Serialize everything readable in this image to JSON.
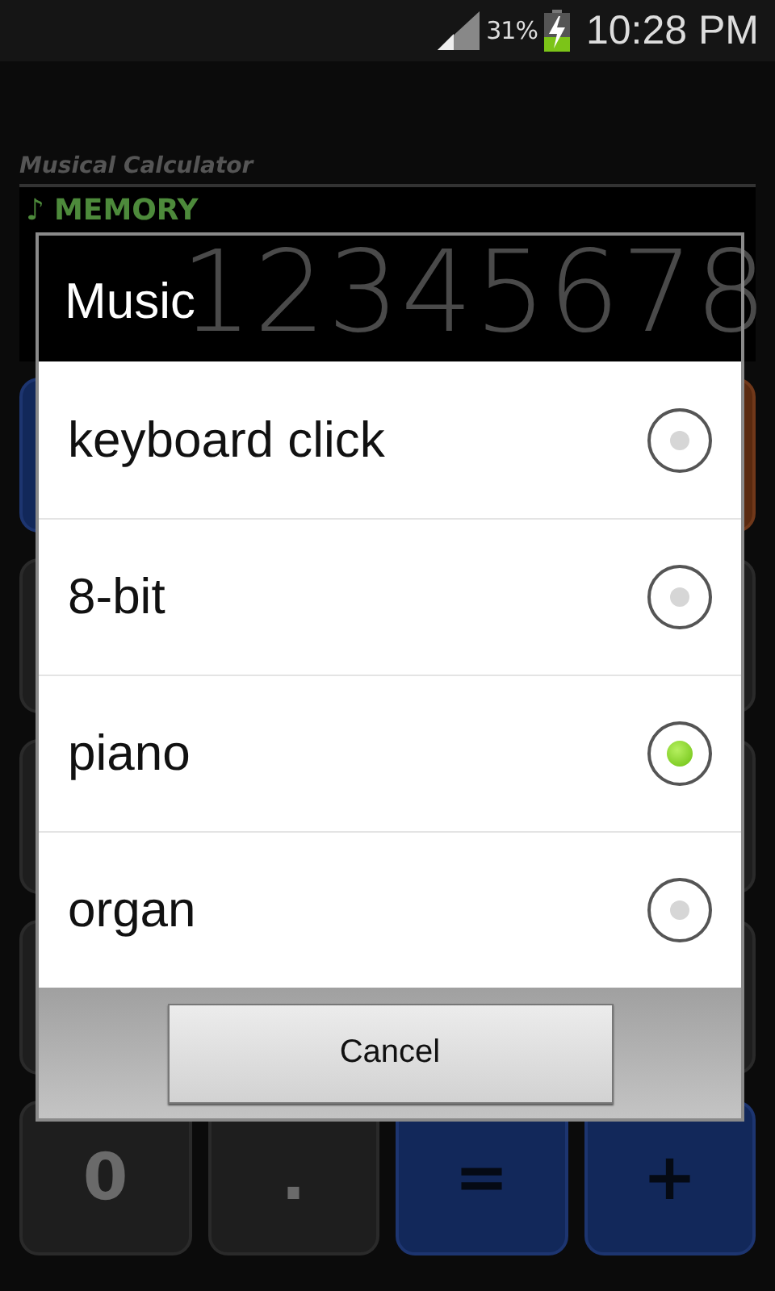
{
  "status_bar": {
    "battery_percent": "31%",
    "time": "10:28 PM"
  },
  "app": {
    "title": "Musical Calculator",
    "memory_icon": "♪",
    "memory_label": "MEMORY",
    "display": "12345678"
  },
  "keypad": {
    "rows": [
      [
        {
          "kind": "operator"
        },
        {
          "kind": "function"
        }
      ],
      [
        {
          "kind": "number"
        },
        {
          "kind": "number"
        }
      ],
      [
        {
          "kind": "number"
        },
        {
          "kind": "number"
        }
      ],
      [
        {
          "kind": "number"
        },
        {
          "kind": "number"
        }
      ],
      [
        {
          "label": "0",
          "kind": "number"
        },
        {
          "label": ".",
          "kind": "number"
        },
        {
          "label": "=",
          "kind": "operator"
        },
        {
          "label": "+",
          "kind": "operator"
        }
      ]
    ]
  },
  "dialog": {
    "title": "Music",
    "options": [
      {
        "label": "keyboard click",
        "selected": false
      },
      {
        "label": "8-bit",
        "selected": false
      },
      {
        "label": "piano",
        "selected": true
      },
      {
        "label": "organ",
        "selected": false
      }
    ],
    "buttons": [
      "Cancel"
    ]
  }
}
